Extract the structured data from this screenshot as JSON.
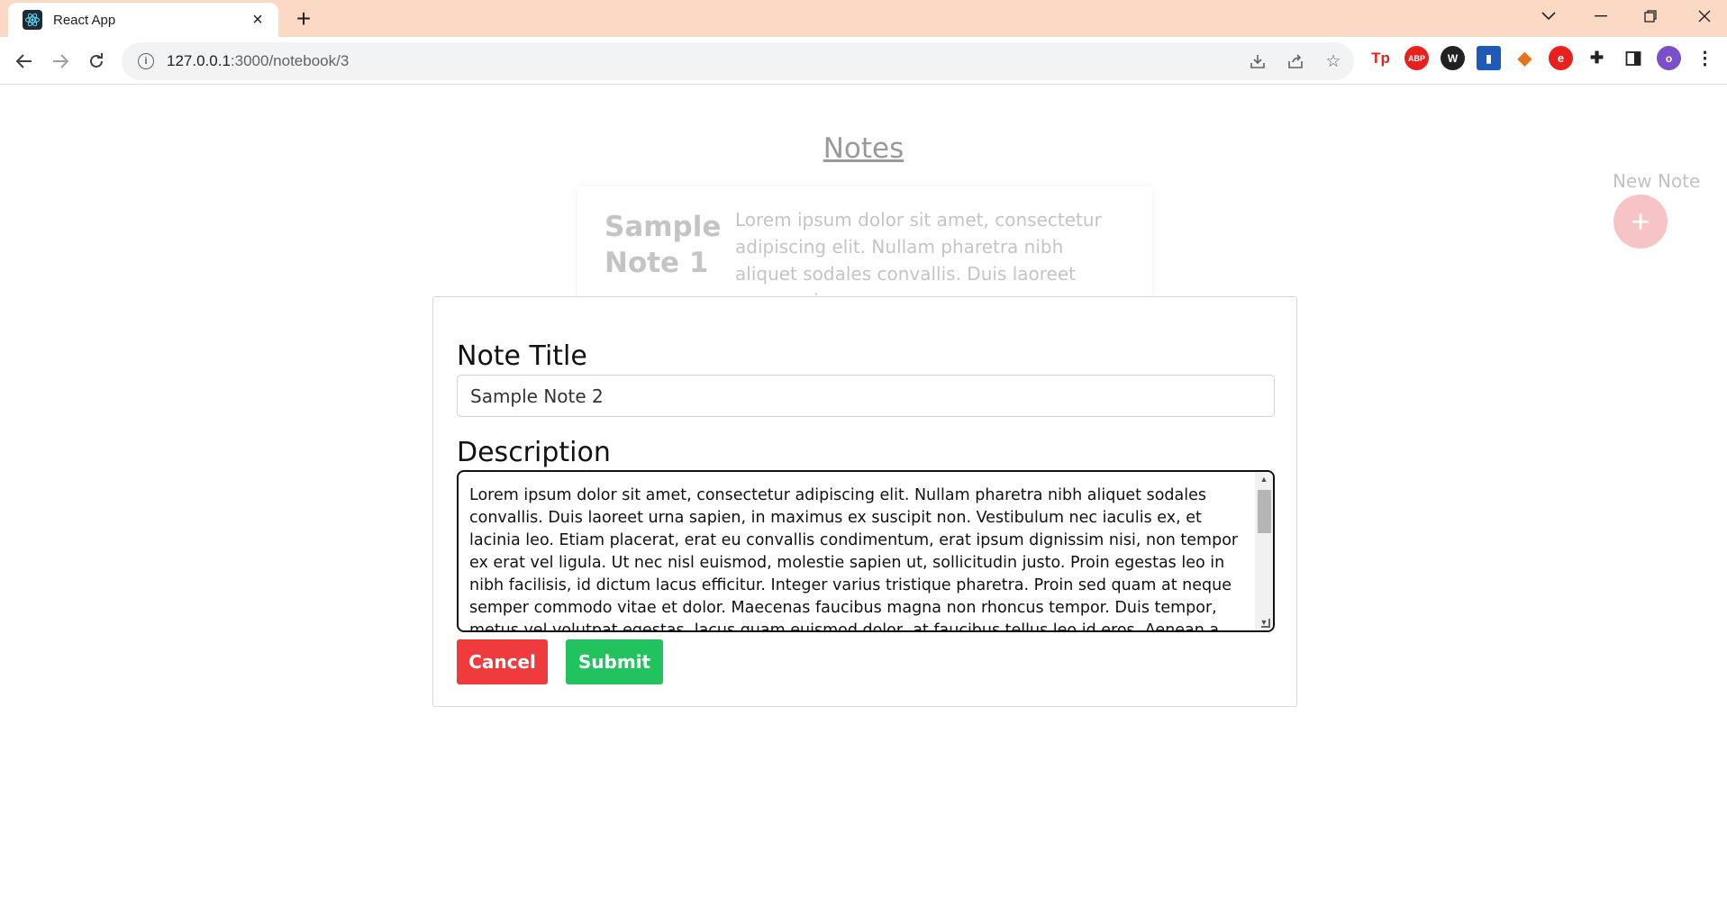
{
  "browser": {
    "tab_title": "React App",
    "url_host": "127.0.0.1",
    "url_path": ":3000/notebook/3"
  },
  "page": {
    "heading": "Notes",
    "new_note_label": "New Note",
    "new_note_symbol": "+"
  },
  "note_card": {
    "title": "Sample Note 1",
    "description": "Lorem ipsum dolor sit amet, consectetur adipiscing elit. Nullam pharetra nibh aliquet sodales convallis. Duis laoreet urna sapien,"
  },
  "modal": {
    "title_label": "Note Title",
    "title_value": "Sample Note 2",
    "description_label": "Description",
    "description_value": "Lorem ipsum dolor sit amet, consectetur adipiscing elit. Nullam pharetra nibh aliquet sodales convallis. Duis laoreet urna sapien, in maximus ex suscipit non. Vestibulum nec iaculis ex, et lacinia leo. Etiam placerat, erat eu convallis condimentum, erat ipsum dignissim nisi, non tempor ex erat vel ligula. Ut nec nisl euismod, molestie sapien ut, sollicitudin justo. Proin egestas leo in nibh facilisis, id dictum lacus efficitur. Integer varius tristique pharetra. Proin sed quam at neque semper commodo vitae et dolor. Maecenas faucibus magna non rhoncus tempor. Duis tempor, metus vel volutpat egestas, lacus quam euismod dolor, at faucibus tellus leo id eros. Aenean a dolor faucibus, condimentum tellus id, vulputate nisl. In pretium lorem ligula, sed feugiat diam",
    "cancel_label": "Cancel",
    "submit_label": "Submit"
  },
  "colors": {
    "tabbar_bg": "#fcd9c5",
    "cancel": "#ef3b3b",
    "submit": "#22c35e",
    "new_note_button": "#f6c3c6"
  }
}
